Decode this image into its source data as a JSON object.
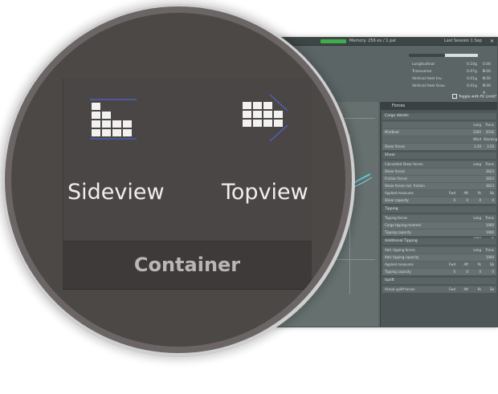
{
  "background_window": {
    "title_left": "Memory: 256 ev / 1 pal",
    "title_right": "Last Session 1 Sep",
    "close_glyph": "✕",
    "stats": [
      {
        "label": "Longitudinal",
        "value": "0.10g",
        "unit": "0.00 g"
      },
      {
        "label": "Transverse",
        "value": "0.07g",
        "unit": "0.00 g"
      },
      {
        "label": "Vertical Heel Inv.",
        "value": "0.01g",
        "unit": "0.00 g"
      },
      {
        "label": "Vertical Heel Grav.",
        "value": "0.01g",
        "unit": "0.00 g"
      }
    ],
    "toggle_label": "Toggle with Fit Limit?",
    "panel_title": "Forces",
    "sections": [
      {
        "title": "Cargo details",
        "rows": [
          {
            "label": "",
            "cells": [
              "Long",
              "Trans"
            ],
            "header": true
          },
          {
            "label": "Min/Boat",
            "cells": [
              "3392",
              "2016"
            ]
          },
          {
            "label": "",
            "cells": [
              "Wind",
              "Stacking"
            ],
            "header": true
          },
          {
            "label": "Shear forces",
            "cells": [
              "3.30",
              "3.50"
            ]
          }
        ]
      },
      {
        "title": "Shear",
        "rows": [
          {
            "label": "Calculated Shear forces",
            "cells": [
              "Long",
              "Trans"
            ],
            "header": true
          },
          {
            "label": "Shear forces",
            "cells": [
              "38.6",
              "3823 N"
            ]
          },
          {
            "label": "Friction forces",
            "cells": [
              "7.5",
              "3823 N"
            ]
          },
          {
            "label": "Shear forces incl. friction",
            "cells": [
              "32.5",
              "3823 N"
            ]
          },
          {
            "label": "Applied measures",
            "cells": [
              "Fwd",
              "Aft",
              "Ps",
              "Sb"
            ],
            "header": true
          },
          {
            "label": "Shear capacity",
            "cells": [
              "0",
              "0",
              "0",
              "0"
            ]
          }
        ]
      },
      {
        "title": "Tipping",
        "rows": [
          {
            "label": "Tipping forces",
            "cells": [
              "Long",
              "Trans"
            ],
            "header": true
          },
          {
            "label": "Cargo tipping moment",
            "cells": [
              "1990",
              "1900 N"
            ]
          },
          {
            "label": "Tipping capacity",
            "cells": [
              "1990",
              "1900 N"
            ]
          }
        ]
      },
      {
        "title": "Additional Tipping",
        "rows": [
          {
            "label": "Add. tipping forces",
            "cells": [
              "Long",
              "Trans"
            ],
            "header": true
          },
          {
            "label": "Add. tipping capacity",
            "cells": [
              "1990",
              "1900 N"
            ]
          },
          {
            "label": "Applied measures",
            "cells": [
              "Fwd",
              "Aft",
              "Ps",
              "Sb"
            ],
            "header": true
          },
          {
            "label": "Tipping capacity",
            "cells": [
              "0",
              "0",
              "0",
              "0"
            ]
          }
        ]
      },
      {
        "title": "Uplift",
        "rows": [
          {
            "label": "Actual uplift forces",
            "cells": [
              "Fwd",
              "Aft",
              "Ps",
              "Sb"
            ],
            "header": true
          }
        ]
      }
    ]
  },
  "zoom": {
    "sideview_label": "Sideview",
    "topview_label": "Topview",
    "group_label": "Container"
  },
  "icons": {
    "sideview": "sideview-icon",
    "topview": "topview-icon"
  },
  "colors": {
    "lens_bg": "#4c4846",
    "footer_band": "#3d3a39",
    "label_text": "#f1efed",
    "group_text": "#b9b6b4",
    "icon_fill": "#f4f2f0",
    "icon_accent": "#4d63c9",
    "accent_green": "#3fae4a"
  }
}
